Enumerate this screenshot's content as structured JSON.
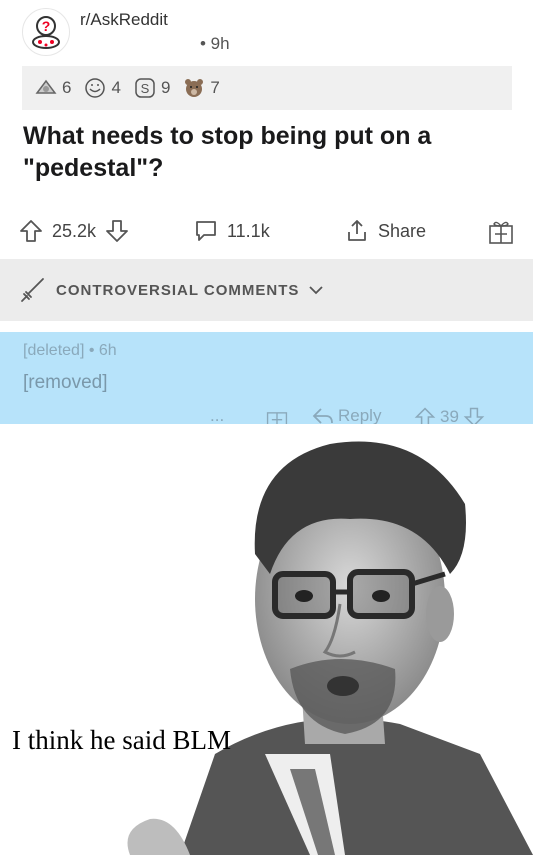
{
  "post": {
    "subreddit": "r/AskReddit",
    "time": "• 9h",
    "title": "What needs to stop being put on a \"pedestal\"?",
    "awards": [
      {
        "icon": "silver-award-icon",
        "count": "6"
      },
      {
        "icon": "laugh-award-icon",
        "count": "4"
      },
      {
        "icon": "cash-award-icon",
        "count": "9"
      },
      {
        "icon": "bear-award-icon",
        "count": "7"
      }
    ],
    "actions": {
      "upvotes": "25.2k",
      "comments": "11.1k",
      "share": "Share"
    }
  },
  "sort": {
    "label": "CONTROVERSIAL COMMENTS"
  },
  "comment": {
    "author": "[deleted]",
    "time": "• 6h",
    "body": "[removed]",
    "more": "...",
    "reply": "Reply",
    "score": "39"
  },
  "meme": {
    "caption": "I think he said BLM"
  },
  "colors": {
    "comment_bg": "#b7e3fa",
    "sort_bg": "#ececec",
    "awards_bg": "#f0f0f0"
  }
}
